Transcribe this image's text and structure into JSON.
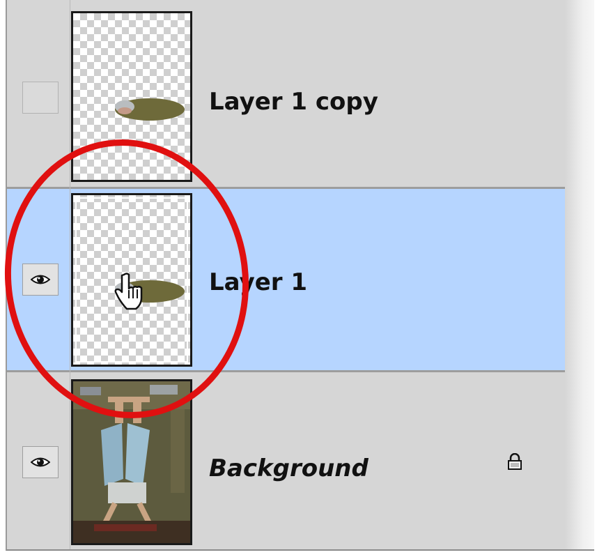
{
  "layers": [
    {
      "name": "Layer 1 copy",
      "visible": false,
      "selected": false,
      "italic": false,
      "locked": false
    },
    {
      "name": "Layer 1",
      "visible": true,
      "selected": true,
      "italic": false,
      "locked": false
    },
    {
      "name": "Background",
      "visible": true,
      "selected": false,
      "italic": true,
      "locked": true
    }
  ],
  "colors": {
    "panel_bg": "#d6d6d6",
    "selected_row": "#b6d5ff",
    "annotation_circle": "#e01010"
  },
  "icons": {
    "visibility": "eye-icon",
    "lock": "lock-icon",
    "cursor": "hand-pointer-icon"
  }
}
